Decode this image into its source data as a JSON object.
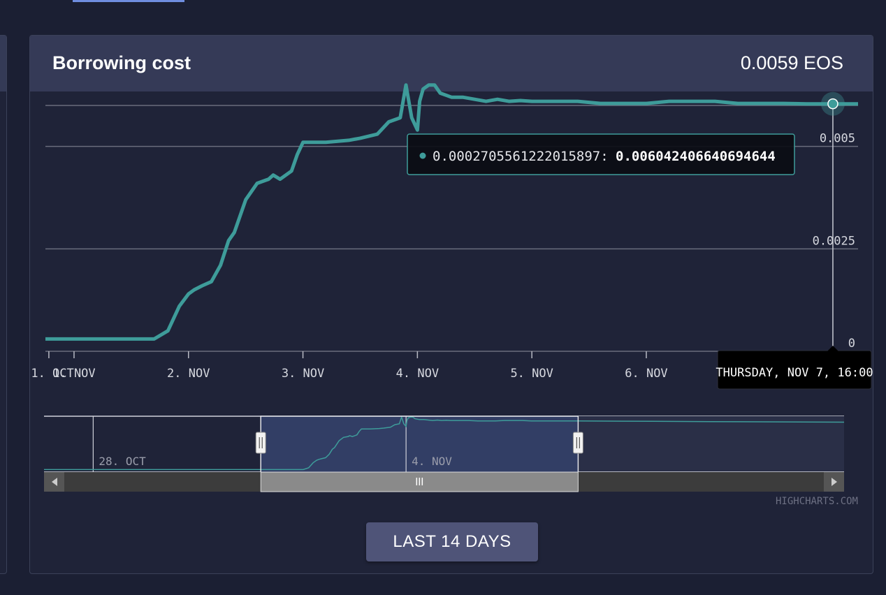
{
  "card": {
    "title": "Borrowing cost",
    "value": "0.0059 EOS"
  },
  "range_button": {
    "label": "LAST 14 DAYS"
  },
  "credits": "HIGHCHARTS.COM",
  "tooltip": {
    "series_label": "0.0002705561222015897",
    "value": "0.006042406640694644"
  },
  "crosshair_label": "THURSDAY, NOV 7, 16:00",
  "colors": {
    "series": "#3e9c9a",
    "background": "#1f2338",
    "header": "#353a57",
    "grid": "#6a6d7c",
    "navigator_mask": "#34416a"
  },
  "chart_data": {
    "type": "line",
    "x_unit": "days since 1 Nov (0 = Nov 1 00:00)",
    "xlim": [
      -0.25,
      6.85
    ],
    "ylim": [
      0,
      0.006
    ],
    "y_ticks": [
      {
        "value": 0,
        "label": "0"
      },
      {
        "value": 0.0025,
        "label": "0.0025"
      },
      {
        "value": 0.005,
        "label": "0.005"
      }
    ],
    "x_ticks": [
      {
        "value": -1,
        "label": "31. OCT"
      },
      {
        "value": 0,
        "label": "1. NOV"
      },
      {
        "value": 1,
        "label": "2. NOV"
      },
      {
        "value": 2,
        "label": "3. NOV"
      },
      {
        "value": 3,
        "label": "4. NOV"
      },
      {
        "value": 4,
        "label": "5. NOV"
      },
      {
        "value": 5,
        "label": "6. NOV"
      }
    ],
    "series": [
      {
        "x": [
          -0.25,
          0.7,
          0.82,
          0.92,
          1.0,
          1.05,
          1.12,
          1.2,
          1.28,
          1.35,
          1.4,
          1.5,
          1.6,
          1.7,
          1.74,
          1.8,
          1.9,
          1.95,
          2.0,
          2.2,
          2.4,
          2.5,
          2.65,
          2.75,
          2.85,
          2.9,
          2.95,
          3.0,
          3.02,
          3.05,
          3.1,
          3.15,
          3.2,
          3.25,
          3.3,
          3.4,
          3.5,
          3.6,
          3.7,
          3.8,
          3.9,
          4.0,
          4.2,
          4.4,
          4.6,
          4.8,
          5.0,
          5.2,
          5.4,
          5.6,
          5.8,
          6.0,
          6.2,
          6.4,
          6.6,
          6.85
        ],
        "y": [
          0.0003,
          0.0003,
          0.0005,
          0.0011,
          0.0014,
          0.0015,
          0.0016,
          0.0017,
          0.0021,
          0.0027,
          0.0029,
          0.0037,
          0.0041,
          0.0042,
          0.0043,
          0.0042,
          0.0044,
          0.0048,
          0.0051,
          0.0051,
          0.00515,
          0.0052,
          0.0053,
          0.0056,
          0.0057,
          0.0065,
          0.0057,
          0.0054,
          0.0061,
          0.0064,
          0.0065,
          0.0065,
          0.0063,
          0.00625,
          0.0062,
          0.0062,
          0.00615,
          0.0061,
          0.00615,
          0.0061,
          0.00612,
          0.0061,
          0.0061,
          0.0061,
          0.00605,
          0.00605,
          0.00605,
          0.0061,
          0.0061,
          0.0061,
          0.00605,
          0.00605,
          0.00605,
          0.00604,
          0.00604,
          0.00604
        ]
      }
    ],
    "navigator": {
      "xlim": [
        -5.1,
        12.8
      ],
      "selected": [
        -0.25,
        6.85
      ],
      "ticks": [
        {
          "value": -4,
          "label": "28. OCT"
        },
        {
          "value": 3,
          "label": "4. NOV"
        }
      ]
    }
  }
}
